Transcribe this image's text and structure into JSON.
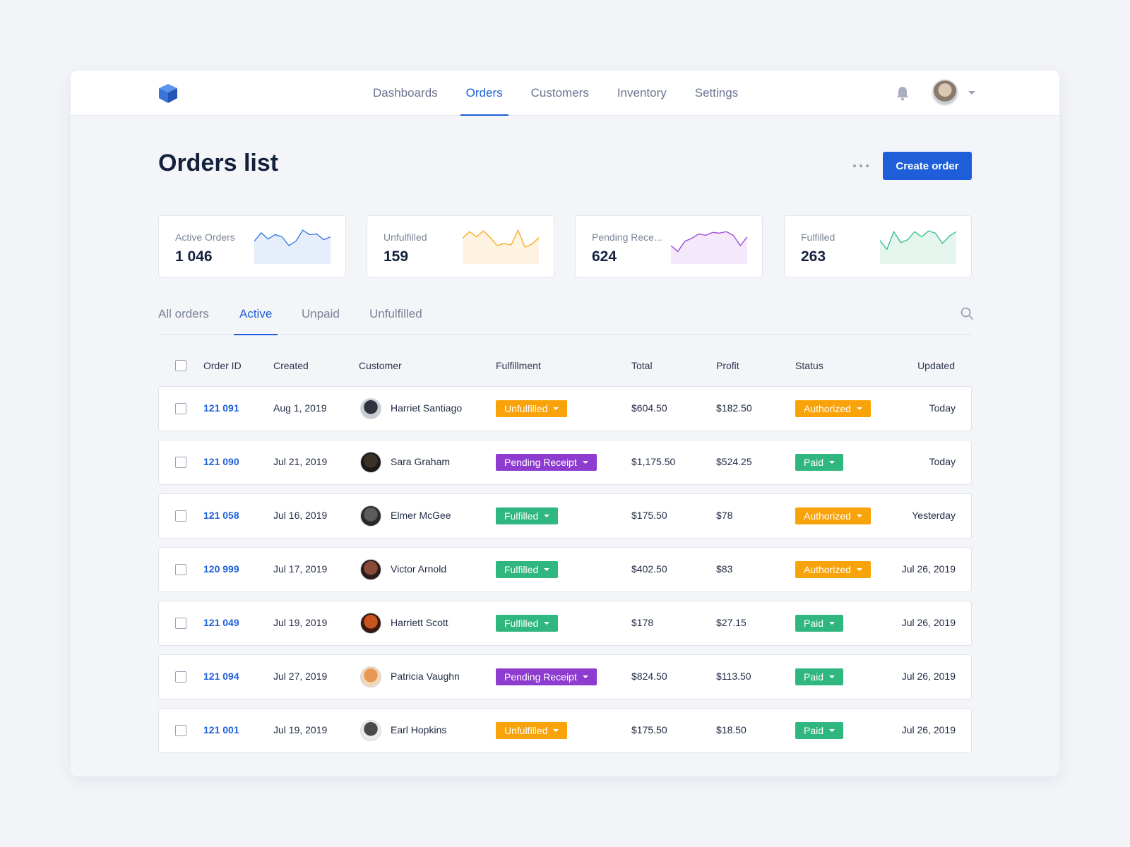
{
  "nav": {
    "items": [
      "Dashboards",
      "Orders",
      "Customers",
      "Inventory",
      "Settings"
    ],
    "active": "Orders"
  },
  "icons": {
    "logo": "cube-logo-icon",
    "notifications": "bell-icon",
    "search": "search-icon",
    "more": "more-horizontal-icon"
  },
  "page": {
    "title": "Orders list",
    "create_label": "Create order"
  },
  "stats": [
    {
      "label": "Active Orders",
      "value": "1 046",
      "color": "#3b7be0",
      "fill": "#e6eefb",
      "trend": [
        62,
        85,
        68,
        80,
        74,
        50,
        62,
        92,
        80,
        82,
        66,
        74
      ]
    },
    {
      "label": "Unfulfilled",
      "value": "159",
      "color": "#f3ad2a",
      "fill": "#fdf3e0",
      "trend": [
        70,
        88,
        74,
        90,
        72,
        50,
        56,
        52,
        92,
        46,
        54,
        72
      ]
    },
    {
      "label": "Pending Rece...",
      "value": "624",
      "color": "#a04ed6",
      "fill": "#f3e9fa",
      "trend": [
        50,
        34,
        62,
        70,
        82,
        78,
        86,
        84,
        88,
        78,
        50,
        74
      ]
    },
    {
      "label": "Fulfilled",
      "value": "263",
      "color": "#3cc08e",
      "fill": "#e4f6ee",
      "trend": [
        64,
        40,
        88,
        58,
        66,
        88,
        74,
        90,
        84,
        56,
        76,
        88
      ]
    }
  ],
  "tabs": {
    "items": [
      "All orders",
      "Active",
      "Unpaid",
      "Unfulfilled"
    ],
    "active": "Active"
  },
  "colors": {
    "accent": "#1e5fd9",
    "unfulfilled": "#f9a30b",
    "pending": "#8e3bcf",
    "fulfilled": "#2fb77f",
    "authorized": "#f9a30b",
    "paid": "#2fb77f"
  },
  "table": {
    "headers": {
      "order_id": "Order ID",
      "created": "Created",
      "customer": "Customer",
      "fulfillment": "Fulfillment",
      "total": "Total",
      "profit": "Profit",
      "status": "Status",
      "updated": "Updated"
    },
    "rows": [
      {
        "order_id": "121 091",
        "created": "Aug 1, 2019",
        "customer": "Harriet Santiago",
        "avatar": [
          "#2f3440",
          "#c9cdd4"
        ],
        "fulfillment": "Unfulfilled",
        "fulfillment_color": "#f9a30b",
        "total": "$604.50",
        "profit": "$182.50",
        "status": "Authorized",
        "status_color": "#f9a30b",
        "updated": "Today"
      },
      {
        "order_id": "121 090",
        "created": "Jul 21, 2019",
        "customer": "Sara Graham",
        "avatar": [
          "#3a3227",
          "#1c1a16"
        ],
        "fulfillment": "Pending Receipt",
        "fulfillment_color": "#8e3bcf",
        "total": "$1,175.50",
        "profit": "$524.25",
        "status": "Paid",
        "status_color": "#2fb77f",
        "updated": "Today"
      },
      {
        "order_id": "121 058",
        "created": "Jul 16, 2019",
        "customer": "Elmer McGee",
        "avatar": [
          "#5b5b5b",
          "#2a2a2a"
        ],
        "fulfillment": "Fulfilled",
        "fulfillment_color": "#2fb77f",
        "total": "$175.50",
        "profit": "$78",
        "status": "Authorized",
        "status_color": "#f9a30b",
        "updated": "Yesterday"
      },
      {
        "order_id": "120 999",
        "created": "Jul 17, 2019",
        "customer": "Victor Arnold",
        "avatar": [
          "#8a4a3a",
          "#2b1c18"
        ],
        "fulfillment": "Fulfilled",
        "fulfillment_color": "#2fb77f",
        "total": "$402.50",
        "profit": "$83",
        "status": "Authorized",
        "status_color": "#f9a30b",
        "updated": "Jul 26, 2019"
      },
      {
        "order_id": "121 049",
        "created": "Jul 19, 2019",
        "customer": "Harriett Scott",
        "avatar": [
          "#c9541e",
          "#3a1a10"
        ],
        "fulfillment": "Fulfilled",
        "fulfillment_color": "#2fb77f",
        "total": "$178",
        "profit": "$27.15",
        "status": "Paid",
        "status_color": "#2fb77f",
        "updated": "Jul 26, 2019"
      },
      {
        "order_id": "121 094",
        "created": "Jul 27, 2019",
        "customer": "Patricia Vaughn",
        "avatar": [
          "#e89a55",
          "#f3d7bd"
        ],
        "fulfillment": "Pending Receipt",
        "fulfillment_color": "#8e3bcf",
        "total": "$824.50",
        "profit": "$113.50",
        "status": "Paid",
        "status_color": "#2fb77f",
        "updated": "Jul 26, 2019"
      },
      {
        "order_id": "121 001",
        "created": "Jul 19, 2019",
        "customer": "Earl Hopkins",
        "avatar": [
          "#4a4a4a",
          "#e9eaec"
        ],
        "fulfillment": "Unfulfilled",
        "fulfillment_color": "#f9a30b",
        "total": "$175.50",
        "profit": "$18.50",
        "status": "Paid",
        "status_color": "#2fb77f",
        "updated": "Jul 26, 2019"
      }
    ]
  }
}
